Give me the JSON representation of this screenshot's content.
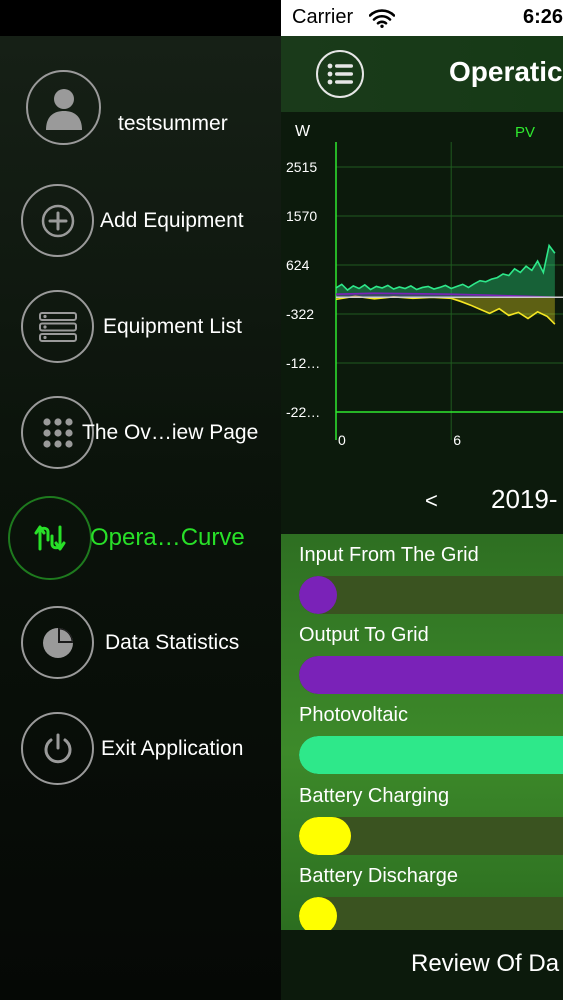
{
  "statusbar": {
    "carrier": "Carrier",
    "time": "6:26"
  },
  "sidebar": {
    "items": [
      {
        "label": "testsummer",
        "icon": "user-avatar-icon",
        "active": false
      },
      {
        "label": "Add Equipment",
        "icon": "plus-icon",
        "active": false
      },
      {
        "label": "Equipment List",
        "icon": "list-icon",
        "active": false
      },
      {
        "label": "The Ov…iew Page",
        "icon": "grid-dots-icon",
        "active": false
      },
      {
        "label": "Opera…Curve",
        "icon": "curve-arrows-icon",
        "active": true
      },
      {
        "label": "Data Statistics",
        "icon": "pie-chart-icon",
        "active": false
      },
      {
        "label": "Exit Application",
        "icon": "power-icon",
        "active": false
      }
    ]
  },
  "header": {
    "title": "Operatic"
  },
  "chart_data": {
    "type": "area",
    "ylabel": "W",
    "legend": [
      "PV"
    ],
    "y_ticks": [
      "2515",
      "1570",
      "624",
      "-322",
      "-12…",
      "-22…"
    ],
    "x_ticks": [
      "0",
      "6"
    ],
    "ylim": [
      -2214,
      2515
    ],
    "grid": true,
    "series": [
      {
        "name": "PV",
        "color": "#2ee88a",
        "x": [
          0,
          0.3,
          0.6,
          0.9,
          1.2,
          1.5,
          1.8,
          2.1,
          2.4,
          2.7,
          3,
          3.3,
          3.6,
          3.9,
          4.2,
          4.5,
          4.8,
          5.1,
          5.4,
          5.7,
          6,
          6.3,
          6.6,
          6.9,
          7.2,
          7.5,
          7.8,
          8.1,
          8.4,
          8.7,
          9,
          9.3,
          9.6,
          9.9,
          10.2,
          10.5,
          10.8,
          11.1,
          11.4
        ],
        "y": [
          180,
          250,
          140,
          220,
          170,
          240,
          150,
          210,
          180,
          230,
          160,
          200,
          170,
          220,
          150,
          190,
          210,
          160,
          190,
          230,
          170,
          210,
          250,
          190,
          260,
          320,
          300,
          350,
          380,
          450,
          420,
          550,
          480,
          600,
          520,
          700,
          480,
          1000,
          850
        ]
      },
      {
        "name": "Battery Discharge",
        "color": "#f5e623",
        "x": [
          0,
          1,
          2,
          3,
          4,
          5,
          6,
          6.5,
          7,
          7.5,
          8,
          8.5,
          9,
          9.5,
          10,
          10.5,
          11,
          11.4
        ],
        "y": [
          -40,
          20,
          -30,
          10,
          -20,
          0,
          -20,
          -80,
          -150,
          -230,
          -310,
          -220,
          -350,
          -290,
          -410,
          -280,
          -370,
          -520
        ]
      },
      {
        "name": "Output To Grid",
        "color": "#7a22b8",
        "x": [
          0,
          2,
          4,
          6,
          8,
          10,
          11.4
        ],
        "y": [
          60,
          80,
          70,
          60,
          40,
          20,
          0
        ]
      }
    ]
  },
  "date": {
    "prev": "<",
    "text": "2019-"
  },
  "bars": [
    {
      "label": "Input From The Grid",
      "color": "#7a22b8",
      "fraction": 0.08
    },
    {
      "label": "Output To Grid",
      "color": "#7a22b8",
      "fraction": 1.0
    },
    {
      "label": "Photovoltaic",
      "color": "#2ee88a",
      "fraction": 1.0
    },
    {
      "label": "Battery Charging",
      "color": "#ffff00",
      "fraction": 0.18
    },
    {
      "label": "Battery Discharge",
      "color": "#ffff00",
      "fraction": 0.13
    }
  ],
  "footer": {
    "text": "Review Of Da"
  }
}
